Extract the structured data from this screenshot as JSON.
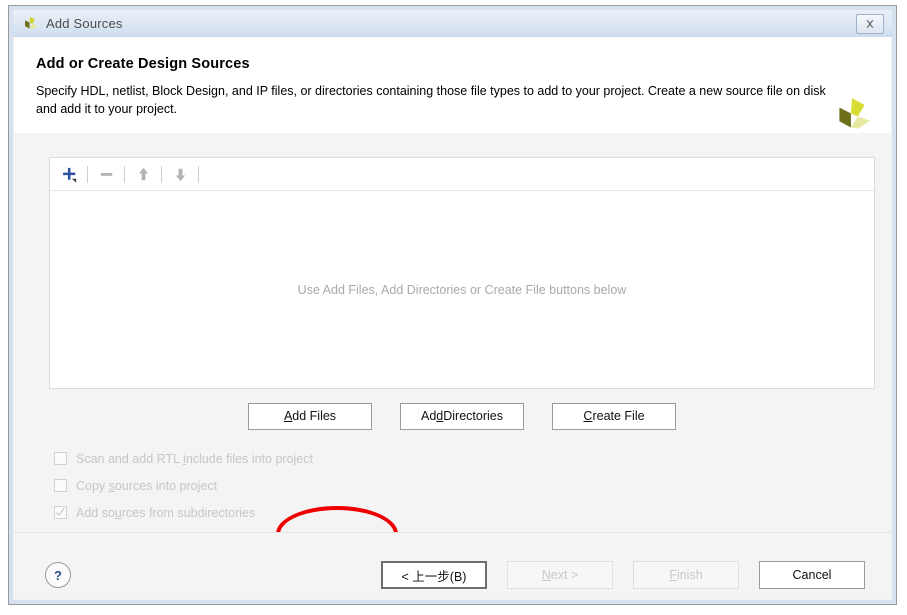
{
  "window": {
    "title": "Add Sources",
    "logo_icon": "vivado-pinwheel-logo",
    "close_icon": "close-icon",
    "close_label": "Close"
  },
  "header": {
    "title": "Add or Create Design Sources",
    "description": "Specify HDL, netlist, Block Design, and IP files, or directories containing those file types to add to your project. Create a new source file on disk and add it to your project.",
    "logo_icon": "vivado-pinwheel-logo"
  },
  "list_panel": {
    "toolbar": [
      {
        "name": "add-icon",
        "glyph": "+",
        "color": "#2a52a0",
        "enabled": true,
        "has_dropdown": true
      },
      {
        "name": "remove-icon",
        "glyph": "−",
        "color": "#b4b4b4",
        "enabled": false,
        "has_dropdown": false
      },
      {
        "name": "move-up-icon",
        "glyph": "↑",
        "color": "#b4b4b4",
        "enabled": false,
        "has_dropdown": false
      },
      {
        "name": "move-down-icon",
        "glyph": "↓",
        "color": "#b4b4b4",
        "enabled": false,
        "has_dropdown": false
      }
    ],
    "empty_message": "Use Add Files, Add Directories or Create File buttons below"
  },
  "actions": [
    {
      "name": "add-files-button",
      "label": "Add Files",
      "mnemonic_index": 0,
      "highlighted": true
    },
    {
      "name": "add-directories-button",
      "label": "Add Directories",
      "mnemonic_index": 2,
      "highlighted": false
    },
    {
      "name": "create-file-button",
      "label": "Create File",
      "mnemonic_index": 0,
      "highlighted": false
    }
  ],
  "annotation": {
    "shape": "ellipse",
    "color": "#ee0000",
    "target": "add-files-button"
  },
  "checkboxes": [
    {
      "name": "scan-rtl-include-checkbox",
      "label": "Scan and add RTL include files into project",
      "checked": false,
      "enabled": false,
      "mnemonic_index": 17
    },
    {
      "name": "copy-sources-checkbox",
      "label": "Copy sources into project",
      "checked": false,
      "enabled": false,
      "mnemonic_index": 5
    },
    {
      "name": "add-subdirectories-checkbox",
      "label": "Add sources from subdirectories",
      "checked": true,
      "enabled": false,
      "mnemonic_index": 15
    }
  ],
  "footer": {
    "help_label": "?",
    "buttons": [
      {
        "name": "back-button",
        "label": "< 上一步(B)",
        "enabled": true,
        "focused": true,
        "mnemonic": "B"
      },
      {
        "name": "next-button",
        "label": "Next >",
        "enabled": false,
        "focused": false,
        "mnemonic": "N"
      },
      {
        "name": "finish-button",
        "label": "Finish",
        "enabled": false,
        "focused": false,
        "mnemonic": "F"
      },
      {
        "name": "cancel-button",
        "label": "Cancel",
        "enabled": true,
        "focused": false,
        "mnemonic": ""
      }
    ]
  }
}
